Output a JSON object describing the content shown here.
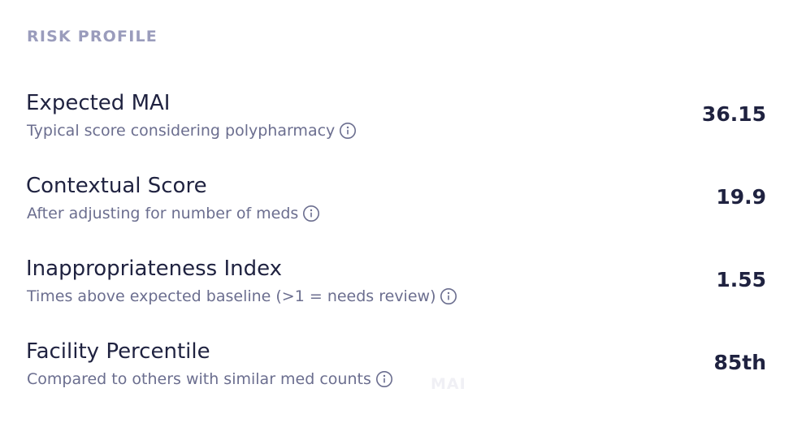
{
  "section": {
    "title": "RISK PROFILE"
  },
  "metrics": [
    {
      "name": "Expected MAI",
      "description": "Typical score considering polypharmacy",
      "value": "36.15",
      "icon": "info-icon"
    },
    {
      "name": "Contextual Score",
      "description": "After adjusting for number of meds",
      "value": "19.9",
      "icon": "info-icon"
    },
    {
      "name": "Inappropriateness Index",
      "description": "Times above expected baseline (>1 = needs review)",
      "value": "1.55",
      "icon": "info-icon"
    },
    {
      "name": "Facility Percentile",
      "description": "Compared to others with similar med counts",
      "value": "85th",
      "icon": "info-icon"
    }
  ],
  "ghost_text": "MAI"
}
